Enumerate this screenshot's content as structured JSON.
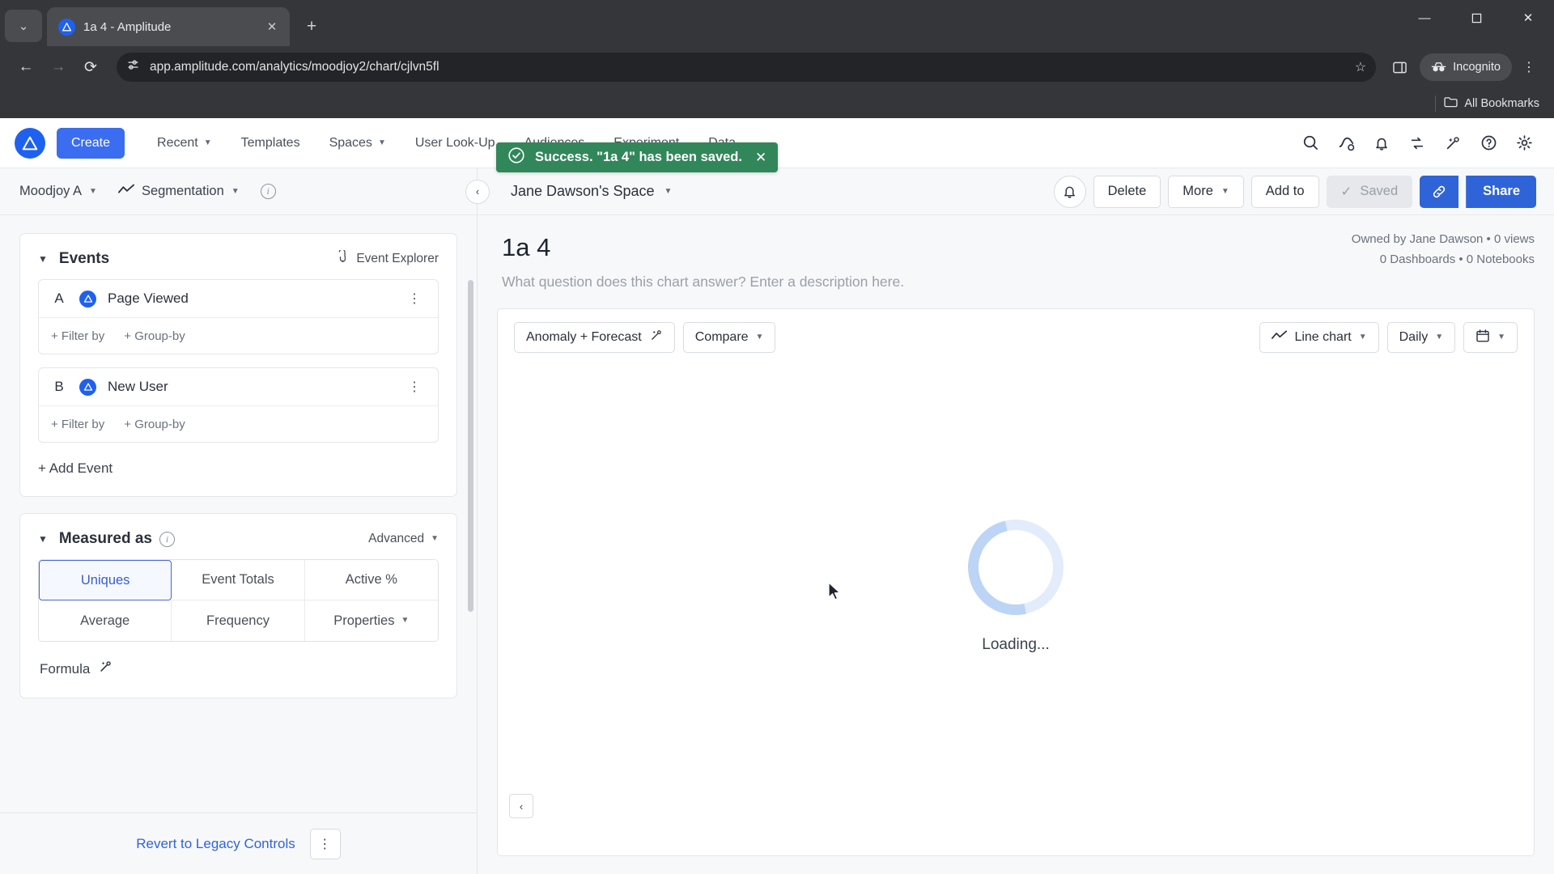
{
  "browser": {
    "tab": {
      "title": "1a 4 - Amplitude",
      "favicon": "amplitude-icon",
      "close": "✕"
    },
    "tab_list_btn": "⌄",
    "new_tab": "+",
    "window": {
      "minimize": "—",
      "maximize": "❐",
      "close": "✕"
    },
    "nav": {
      "back": "←",
      "forward": "→",
      "reload": "⟳"
    },
    "omnibox": {
      "url": "app.amplitude.com/analytics/moodjoy2/chart/cjlvn5fl",
      "site_info_icon": "site-settings-icon",
      "star": "☆"
    },
    "side_panel_icon": "side-panel-icon",
    "incognito_label": "Incognito",
    "menu_icon": "⋮",
    "bookmarks": {
      "label": "All Bookmarks",
      "icon": "folder-icon"
    }
  },
  "header": {
    "logo": "amplitude-logo",
    "create_label": "Create",
    "nav_items": [
      {
        "label": "Recent",
        "has_caret": true
      },
      {
        "label": "Templates",
        "has_caret": false
      },
      {
        "label": "Spaces",
        "has_caret": true
      },
      {
        "label": "User Look-Up",
        "has_caret": false
      },
      {
        "label": "Audiences",
        "has_caret": false
      },
      {
        "label": "Experiment",
        "has_caret": false
      },
      {
        "label": "Data",
        "has_caret": false
      }
    ],
    "right_icons": [
      "search-icon",
      "analytics-icon",
      "bell-icon",
      "compare-icon",
      "magic-wand-icon",
      "help-icon",
      "gear-icon"
    ]
  },
  "toast": {
    "icon": "check-circle-icon",
    "message": "Success. \"1a 4\" has been saved.",
    "close": "✕",
    "color": "#31875a"
  },
  "sidebar": {
    "project": "Moodjoy A",
    "chart_type": "Segmentation",
    "chart_type_icon": "line-chart-icon",
    "info_icon": "info-icon",
    "events": {
      "title": "Events",
      "explorer_label": "Event Explorer",
      "explorer_icon": "event-explorer-icon",
      "rows": [
        {
          "letter": "A",
          "name": "Page Viewed",
          "filter": "+ Filter by",
          "group": "+ Group-by"
        },
        {
          "letter": "B",
          "name": "New User",
          "filter": "+ Filter by",
          "group": "+ Group-by"
        }
      ],
      "add_event": "+ Add Event"
    },
    "measured_as": {
      "title": "Measured as",
      "advanced_label": "Advanced",
      "tabs": [
        {
          "label": "Uniques",
          "active": true,
          "caret": false
        },
        {
          "label": "Event Totals",
          "active": false,
          "caret": false
        },
        {
          "label": "Active %",
          "active": false,
          "caret": false
        },
        {
          "label": "Average",
          "active": false,
          "caret": false
        },
        {
          "label": "Frequency",
          "active": false,
          "caret": false
        },
        {
          "label": "Properties",
          "active": false,
          "caret": true
        }
      ],
      "formula_label": "Formula",
      "formula_icon": "magic-wand-icon"
    },
    "footer": {
      "legacy_link": "Revert to Legacy Controls",
      "kebab": "⋮"
    }
  },
  "main": {
    "collapse_icon": "‹",
    "space_name": "Jane Dawson's Space",
    "actions": {
      "bell_icon": "bell-icon",
      "delete": "Delete",
      "more": "More",
      "add_to": "Add to",
      "saved": "Saved",
      "saved_check": "✓",
      "link_icon": "link-icon",
      "share": "Share"
    },
    "chart_title": "1a 4",
    "chart_description": "What question does this chart answer? Enter a description here.",
    "owner_line1": "Owned by Jane Dawson • 0 views",
    "owner_line2": "0 Dashboards • 0 Notebooks",
    "toolbar": {
      "anomaly": "Anomaly + Forecast",
      "anomaly_icon": "magic-wand-icon",
      "compare": "Compare",
      "chart_type": "Line chart",
      "chart_type_icon": "line-chart-icon",
      "interval": "Daily",
      "date_icon": "calendar-icon"
    },
    "loading_text": "Loading...",
    "bottom_collapse_icon": "‹"
  }
}
